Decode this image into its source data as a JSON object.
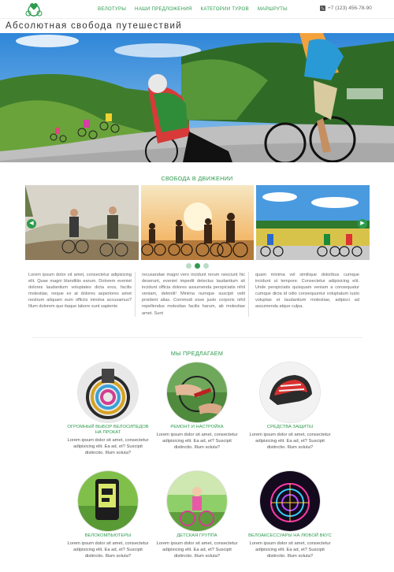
{
  "header": {
    "nav": [
      "Велотуры",
      "Наши предложения",
      "Категории туров",
      "Маршруты"
    ],
    "phone": "+7 (123) 456-78-90",
    "page_title": "Абсолютная свобода путешествий"
  },
  "section1": {
    "title": "Свобода в движении",
    "columns": [
      "Lorem ipsum dolor sit amet, consectetur adipisicing elit. Quae magni blanditiis earum. Dolorem eveniet dolores laudantium voluptates dicta eros, facilis molestiae, neque ex at dolores asperiores amet nostrum aliquam eum officiis minima accusamus? Illum dolorem que itaque labore sunt sapiente",
      "recusandae magni vero incidunt rerum nesciunt hic deserunt, eveniet impedit delectus laudantium sit incidunt officia dolores assumenda perspiciatis nihil veniam, deleniti! Minima numque suscipit velit proident alias. Commodi esse justo corporis nihil repellendus molestias facilis harum, ab molestiae amet. Sunt",
      "quam minima vel similique doloribus cumque incidunt ut tempore. Consectetur adipisicing elit. Unde perspiciatis quisquam veniam a consequatur cumque dicta id odio consequuntur voluptatum iusto voluptas et laudantium molestiae, adipisci ad assumenda atque culpa."
    ]
  },
  "section2": {
    "title": "Мы предлагаем",
    "cards": [
      {
        "title": "Огромный выбор велосипедов на прокат",
        "text": "Lorem ipsum dolor sit amet, consectetur adipisicing elit. Ea ad, et? Suscipit distinctio. Illum soluta?"
      },
      {
        "title": "Ремонт и настройка",
        "text": "Lorem ipsum dolor sit amet, consectetur adipisicing elit. Ea ad, et? Suscipit distinctio. Illum soluta?"
      },
      {
        "title": "Средства защиты",
        "text": "Lorem ipsum dolor sit amet, consectetur adipisicing elit. Ea ad, et? Suscipit distinctio. Illum soluta?"
      },
      {
        "title": "Велокомпьютеры",
        "text": "Lorem ipsum dolor sit amet, consectetur adipisicing elit. Ea ad, et? Suscipit distinctio. Illum soluta?"
      },
      {
        "title": "Детская группа",
        "text": "Lorem ipsum dolor sit amet, consectetur adipisicing elit. Ea ad, et? Suscipit distinctio. Illum soluta?"
      },
      {
        "title": "Велоаксессуары на любой вкус",
        "text": "Lorem ipsum dolor sit amet, consectetur adipisicing elit. Ea ad, et? Suscipit distinctio. Illum soluta?"
      }
    ]
  },
  "carousel": {
    "slide_count": 3,
    "active_dot": 1
  },
  "colors": {
    "accent": "#2e9b4e"
  },
  "icons": [
    "logo-icon",
    "phone-icon",
    "arrow-left-icon",
    "arrow-right-icon"
  ]
}
